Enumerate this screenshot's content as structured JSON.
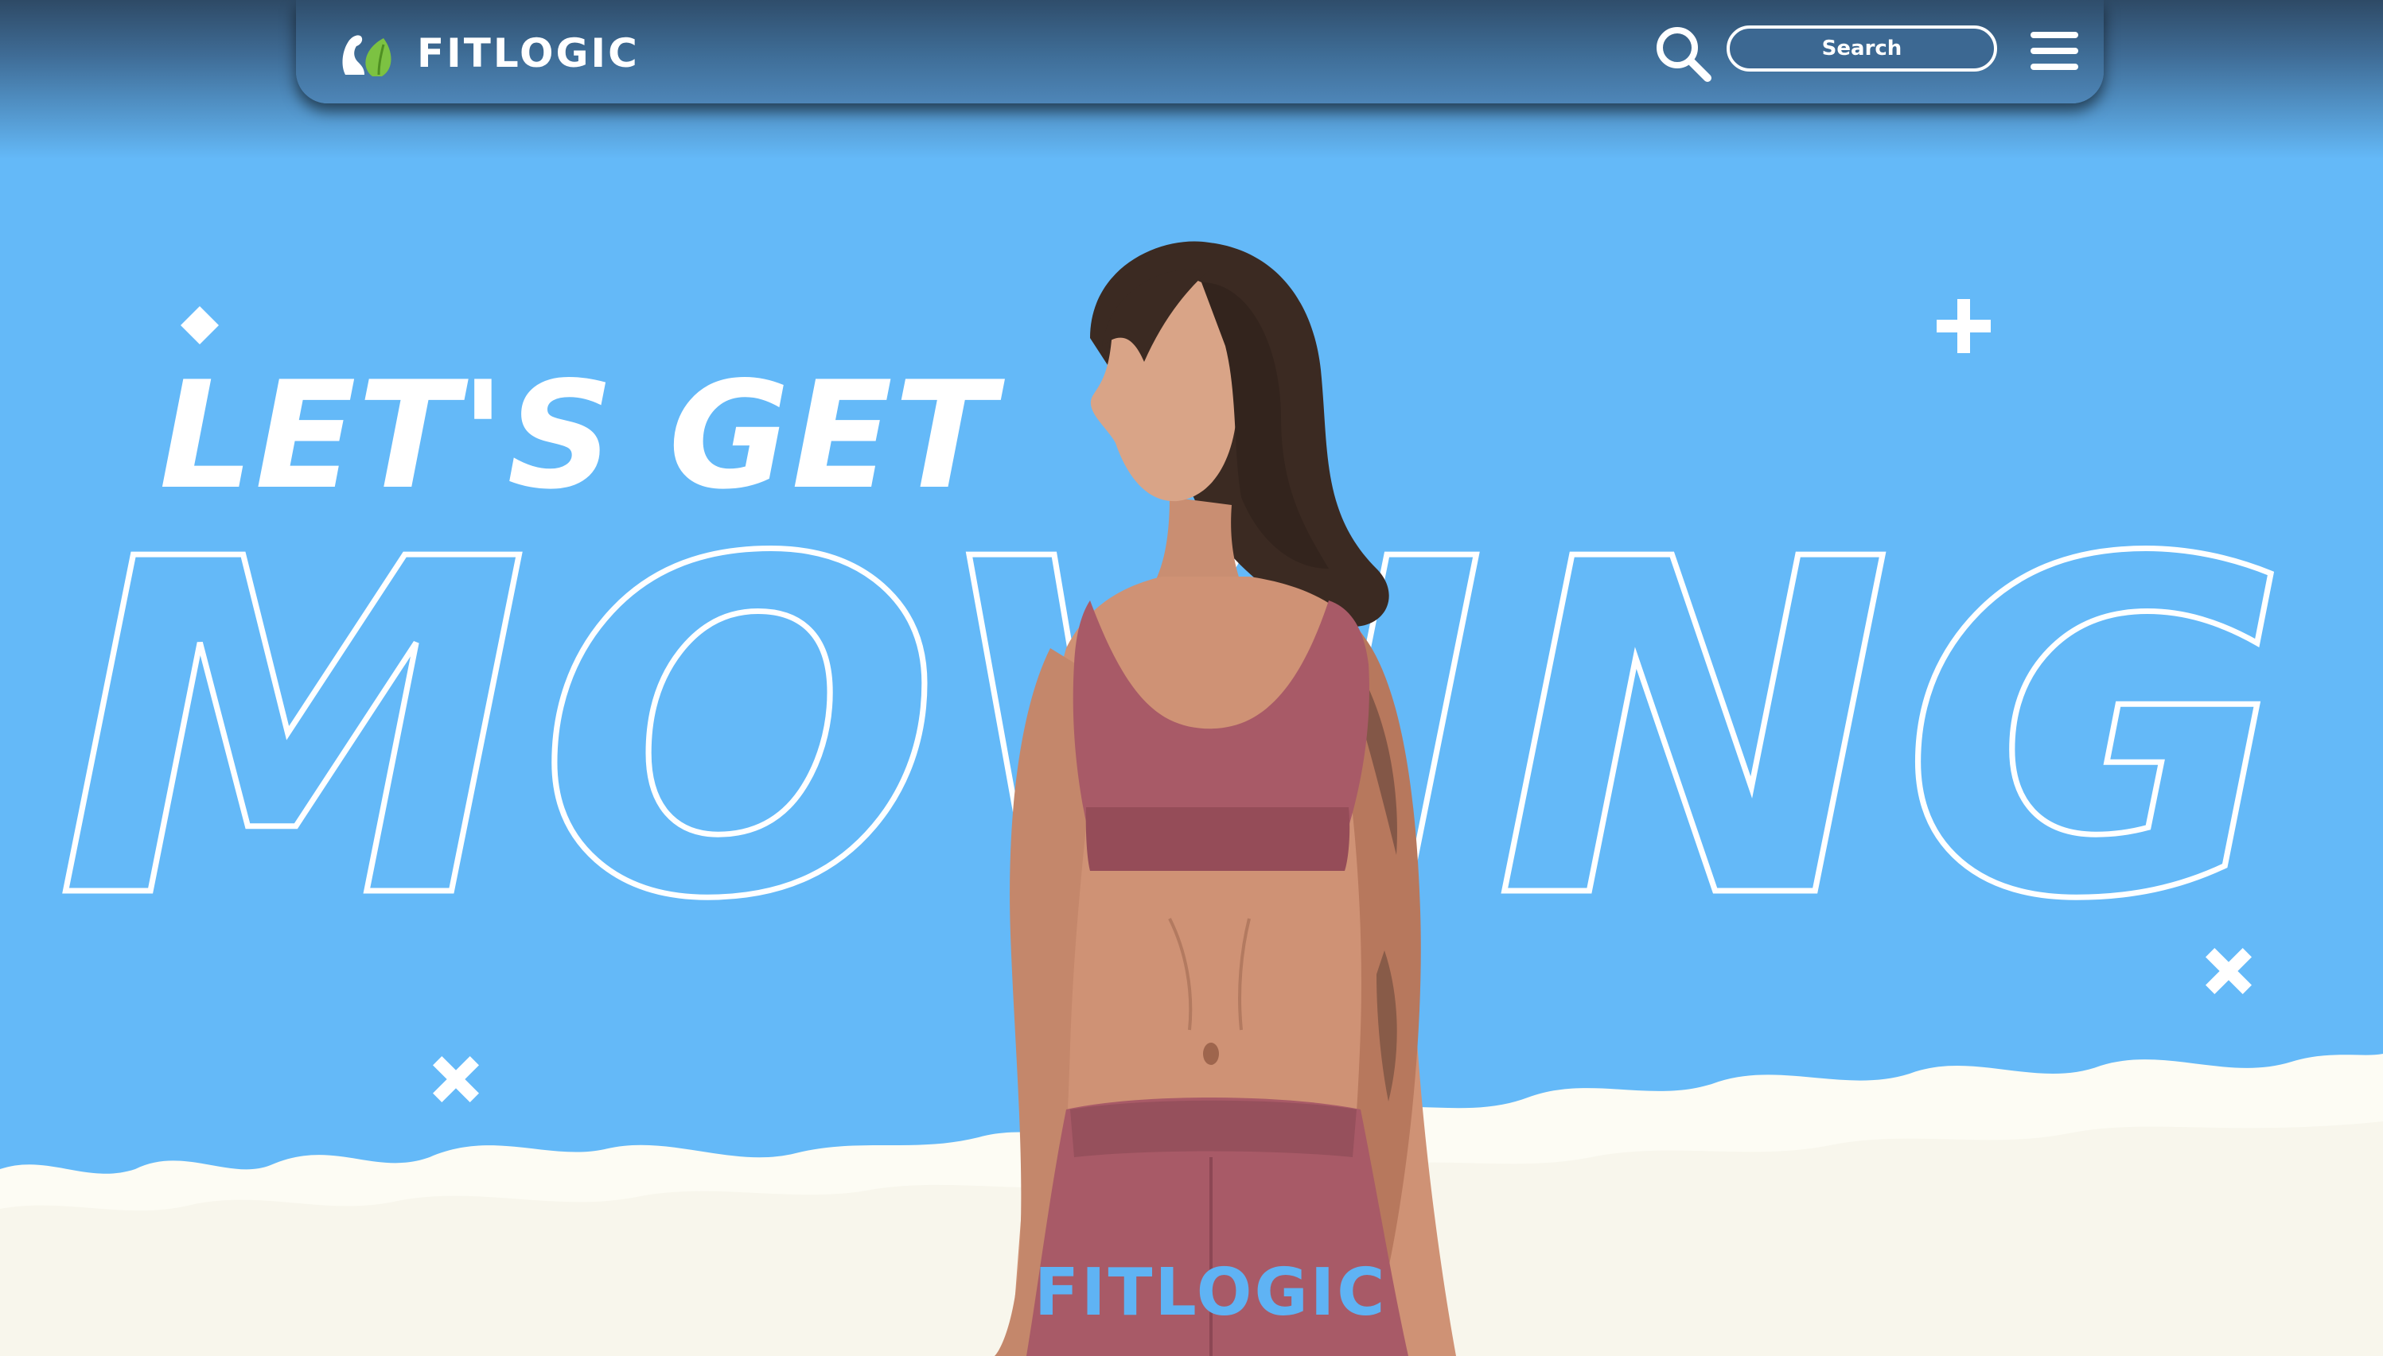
{
  "header": {
    "brand_name": "FITLOGIC",
    "logo_icon": "flexed-arm-leaf-logo",
    "search_icon": "search-icon",
    "search_placeholder": "Search",
    "menu_icon": "hamburger-menu-icon"
  },
  "hero": {
    "headline_top": "LET'S GET",
    "headline_big": "MOVING",
    "image": "woman-in-mauve-sports-bra-and-leggings",
    "decorations": [
      "diamond-icon",
      "plus-icon",
      "close-x-icon",
      "close-x-icon"
    ]
  },
  "footer": {
    "brand_name": "FITLOGIC"
  },
  "colors": {
    "background": "#64b9f8",
    "nav": "#3f6e98",
    "text": "#ffffff",
    "accent_leaf": "#7cc242",
    "cloud": "#fdfcf4",
    "outfit": "#a85a67"
  }
}
